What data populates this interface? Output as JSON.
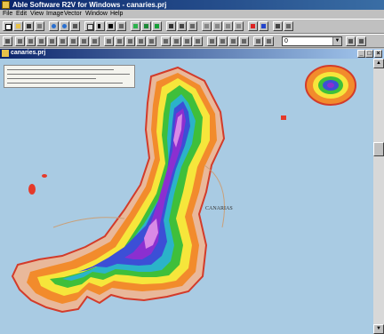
{
  "app": {
    "title": "Able Software R2V for Windows - canaries.prj"
  },
  "menu": [
    "File",
    "Edit",
    "View",
    "Image",
    "Vector",
    "Window",
    "Help"
  ],
  "toolbar": {
    "layer_value": "0"
  },
  "document": {
    "title": "canaries.prj"
  },
  "map": {
    "place_label": "CANARIAS"
  },
  "scrollbar": {
    "up": "▲",
    "down": "▼"
  },
  "colors": {
    "sea": "#a9cbe3",
    "titlebar": "#0a246a",
    "contour_low": "#e53a2a",
    "contour_mid": "#f6e63b",
    "contour_high": "#8b2fd0"
  }
}
